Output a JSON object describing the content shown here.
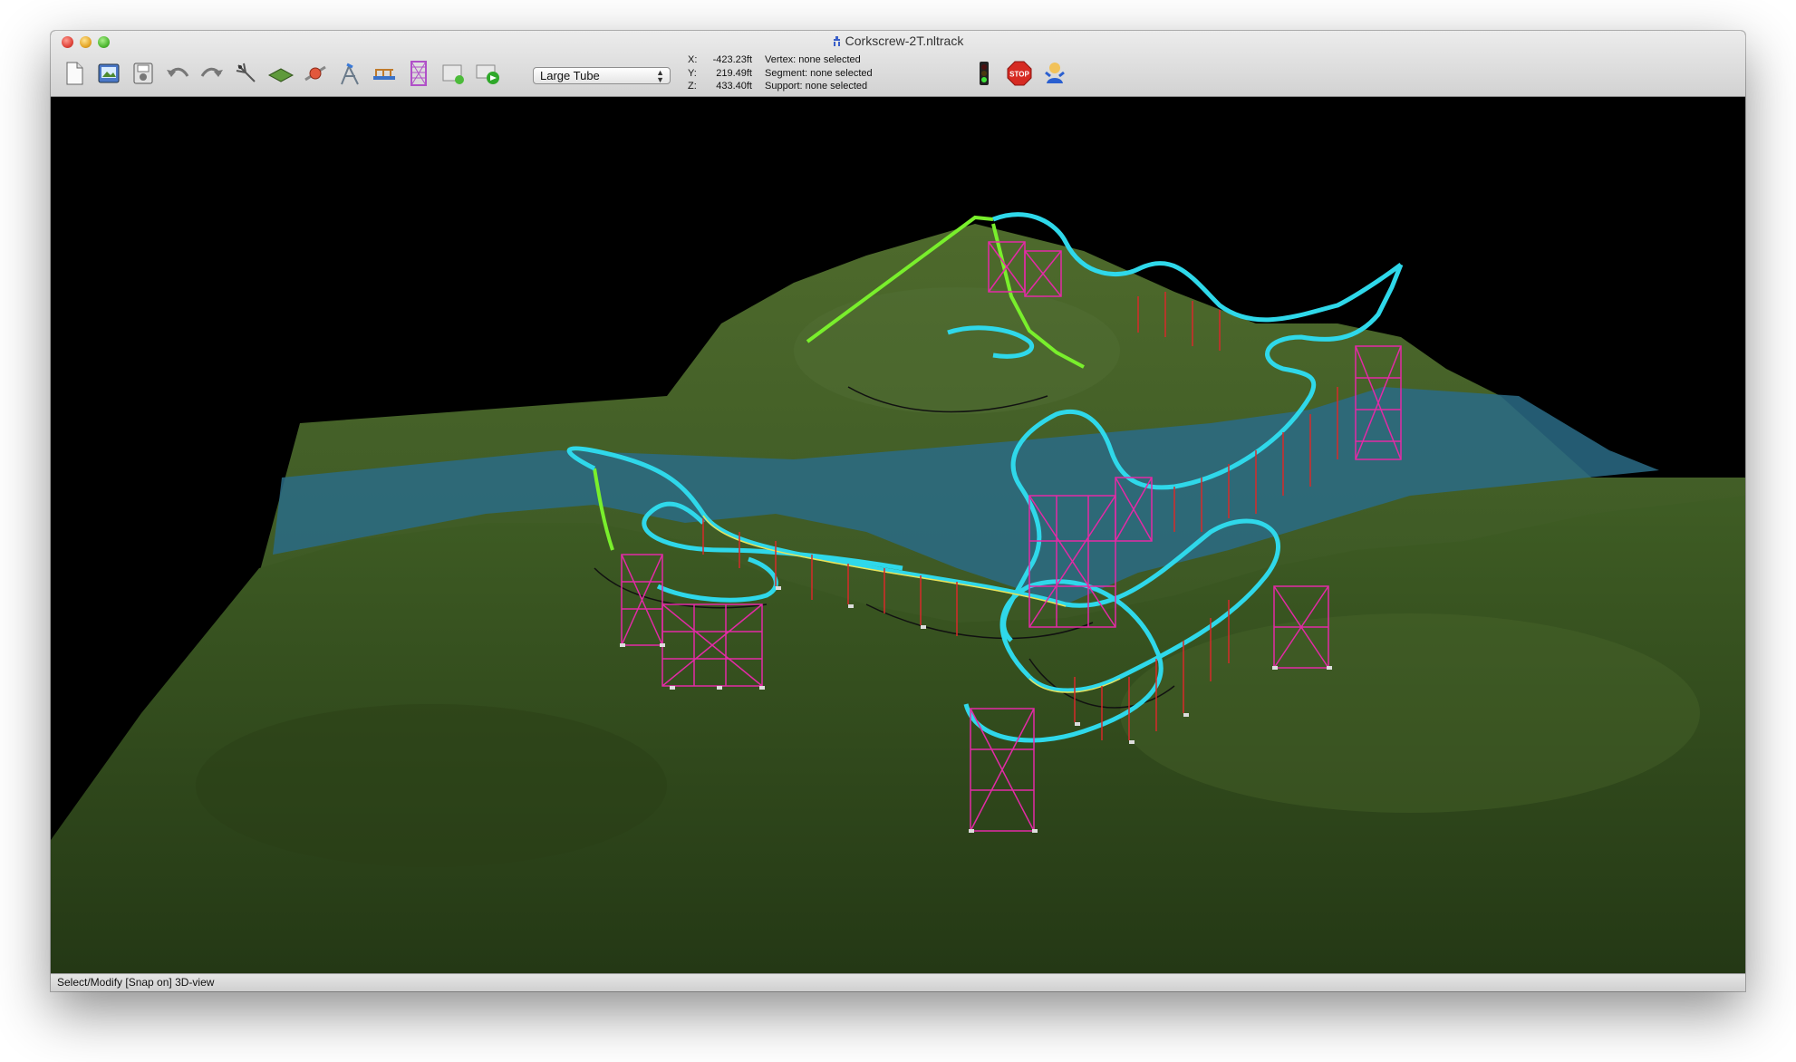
{
  "window": {
    "title": "Corkscrew-2T.nltrack"
  },
  "toolbar": {
    "tools": [
      {
        "name": "new-document-icon"
      },
      {
        "name": "open-track-icon"
      },
      {
        "name": "save-track-icon"
      },
      {
        "name": "undo-icon"
      },
      {
        "name": "redo-icon"
      },
      {
        "name": "select-vertex-icon"
      },
      {
        "name": "terrain-icon"
      },
      {
        "name": "add-vertex-icon"
      },
      {
        "name": "support-tool-icon"
      },
      {
        "name": "catwalk-icon"
      },
      {
        "name": "lattice-support-icon"
      },
      {
        "name": "export-icon"
      },
      {
        "name": "test-run-icon"
      }
    ],
    "tube_type": "Large Tube",
    "right_tools": [
      {
        "name": "traffic-light-icon"
      },
      {
        "name": "stop-icon"
      },
      {
        "name": "rider-icon"
      }
    ],
    "stop_label": "STOP"
  },
  "coordinates": {
    "x_label": "X:",
    "x_value": "-423.23ft",
    "y_label": "Y:",
    "y_value": "219.49ft",
    "z_label": "Z:",
    "z_value": "433.40ft"
  },
  "selection": {
    "vertex": "Vertex: none selected",
    "segment": "Segment: none selected",
    "support": "Support: none selected"
  },
  "status": {
    "text": "Select/Modify [Snap on] 3D-view"
  },
  "colors": {
    "track": "#2fd8ea",
    "lift": "#79ef2c",
    "support": "#e32aa6",
    "terrain": "#3f5a22",
    "water": "#2a6b86"
  }
}
